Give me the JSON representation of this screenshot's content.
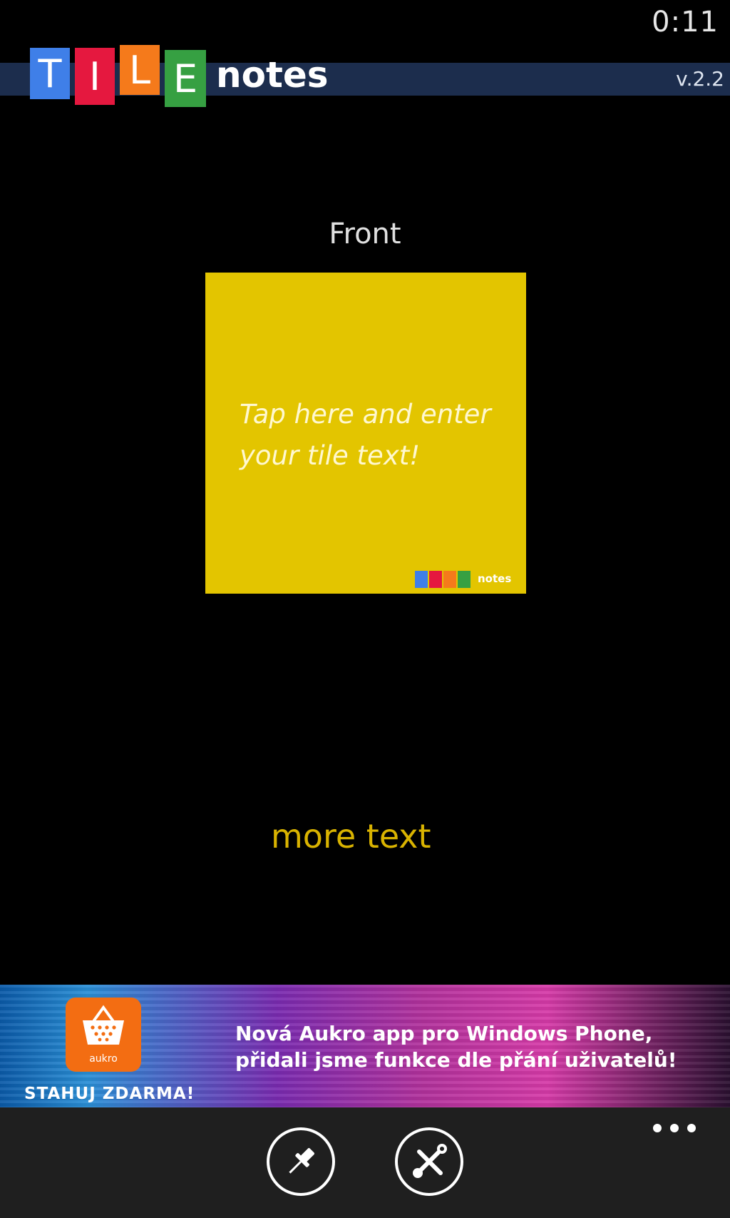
{
  "status_bar": {
    "time": "0:11"
  },
  "header": {
    "logo_letters": [
      {
        "letter": "T",
        "color": "#3f7fe8"
      },
      {
        "letter": "I",
        "color": "#e5183f"
      },
      {
        "letter": "L",
        "color": "#f57a1b"
      },
      {
        "letter": "E",
        "color": "#36a042"
      }
    ],
    "logo_word": "notes",
    "version": "v.2.2"
  },
  "editor": {
    "face_label": "Front",
    "tile_color": "#e3c500",
    "tile_text": "Tap here and enter your tile text!",
    "mini_logo_word": "notes",
    "more_text_link": "more text"
  },
  "ad": {
    "app_label": "aukro",
    "cta": "STAHUJ ZDARMA!",
    "headline_line1": "Nová Aukro app pro Windows Phone,",
    "headline_line2": "přidali jsme funkce dle přání uživatelů!"
  },
  "app_bar": {
    "buttons": [
      {
        "name": "pin",
        "icon": "pin-icon"
      },
      {
        "name": "settings",
        "icon": "tools-icon"
      }
    ],
    "more_icon": "ellipsis-icon"
  }
}
